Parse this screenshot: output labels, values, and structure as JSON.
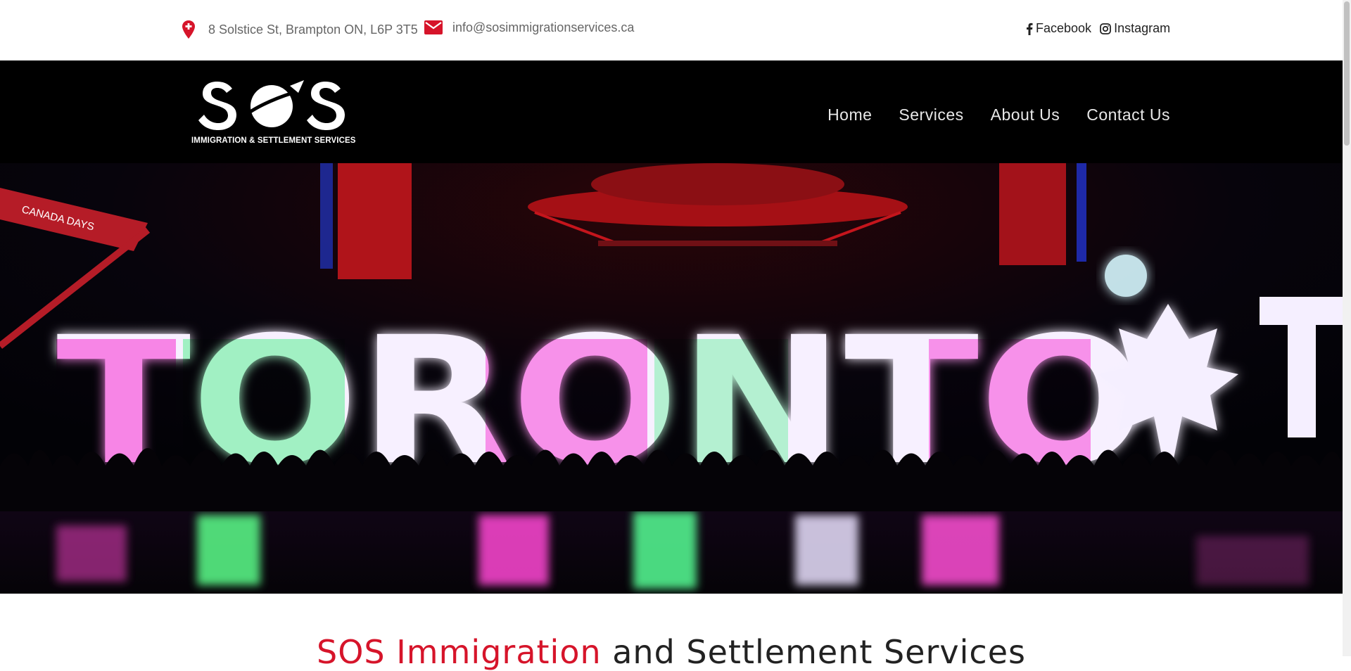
{
  "topbar": {
    "address": "8 Solstice St, Brampton ON, L6P 3T5",
    "email": "info@sosimmigrationservices.ca",
    "social": [
      {
        "label": "Facebook",
        "icon": "facebook-icon"
      },
      {
        "label": "Instagram",
        "icon": "instagram-icon"
      }
    ]
  },
  "logo": {
    "word": "SOS",
    "tagline": "IMMIGRATION & SETTLEMENT SERVICES"
  },
  "nav": {
    "items": [
      "Home",
      "Services",
      "About Us",
      "Contact Us"
    ]
  },
  "hero": {
    "sign_text": "TORONTO",
    "banner_text": "CANADA DAYS"
  },
  "headline": {
    "highlight": "SOS Immigration",
    "rest": " and Settlement Services"
  },
  "colors": {
    "accent": "#d6142a",
    "header_bg": "#000000",
    "sign_pink": "#ff3fd8",
    "sign_white": "#f7f0ff",
    "sign_green": "#39ff7a"
  }
}
